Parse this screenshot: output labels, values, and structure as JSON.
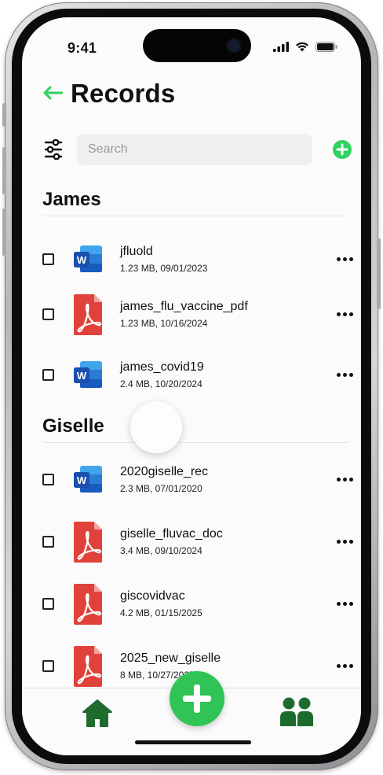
{
  "status_bar": {
    "time": "9:41"
  },
  "header": {
    "title": "Records",
    "back_icon": "back-arrow-icon"
  },
  "search": {
    "placeholder": "Search"
  },
  "colors": {
    "accent": "#2fd160",
    "fab": "#2fc455",
    "tab_icons": "#1e6b2e",
    "pdf_red": "#e0423b",
    "word_blue": "#1f55b5"
  },
  "groups": [
    {
      "name": "James",
      "files": [
        {
          "name": "jfluold",
          "meta": "1.23 MB, 09/01/2023",
          "type": "word"
        },
        {
          "name": "james_flu_vaccine_pdf",
          "meta": "1.23 MB, 10/16/2024",
          "type": "pdf"
        },
        {
          "name": "james_covid19",
          "meta": "2.4 MB, 10/20/2024",
          "type": "word"
        }
      ]
    },
    {
      "name": "Giselle",
      "files": [
        {
          "name": "2020giselle_rec",
          "meta": "2.3 MB, 07/01/2020",
          "type": "word"
        },
        {
          "name": "giselle_fluvac_doc",
          "meta": "3.4 MB, 09/10/2024",
          "type": "pdf"
        },
        {
          "name": "giscovidvac",
          "meta": "4.2 MB, 01/15/2025",
          "type": "pdf"
        },
        {
          "name": "2025_new_giselle",
          "meta": "8 MB, 10/27/2025",
          "type": "pdf"
        }
      ]
    }
  ],
  "tab_bar": {
    "items": [
      "home-icon",
      "add-icon",
      "people-icon"
    ]
  }
}
